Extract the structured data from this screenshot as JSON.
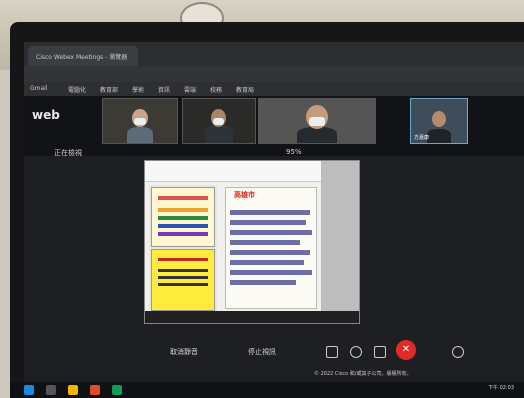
{
  "browser": {
    "tab_title": "Cisco Webex Meetings - 瀏覽器",
    "bookmarks": [
      "Gmail",
      "電腦化",
      "教育部",
      "學術",
      "資訊",
      "雲端",
      "校務",
      "教育局"
    ]
  },
  "webex": {
    "logo": "web",
    "sharing_label": "正在檢視",
    "zoom_label": "95%",
    "participants": [
      {
        "name": ""
      },
      {
        "name": ""
      },
      {
        "name": ""
      },
      {
        "name": "方嘉康"
      }
    ]
  },
  "slide": {
    "title": "高雄市"
  },
  "controls": {
    "mute_label": "取消靜音",
    "stop_video_label": "停止視訊",
    "end_icon": "✕"
  },
  "footer": "© 2022 Cisco 和/或其子公司。版權所有。",
  "taskbar": {
    "time": "下午 02:03"
  },
  "colors": {
    "end_button": "#e02b2b",
    "slide_title": "#d6261c"
  }
}
